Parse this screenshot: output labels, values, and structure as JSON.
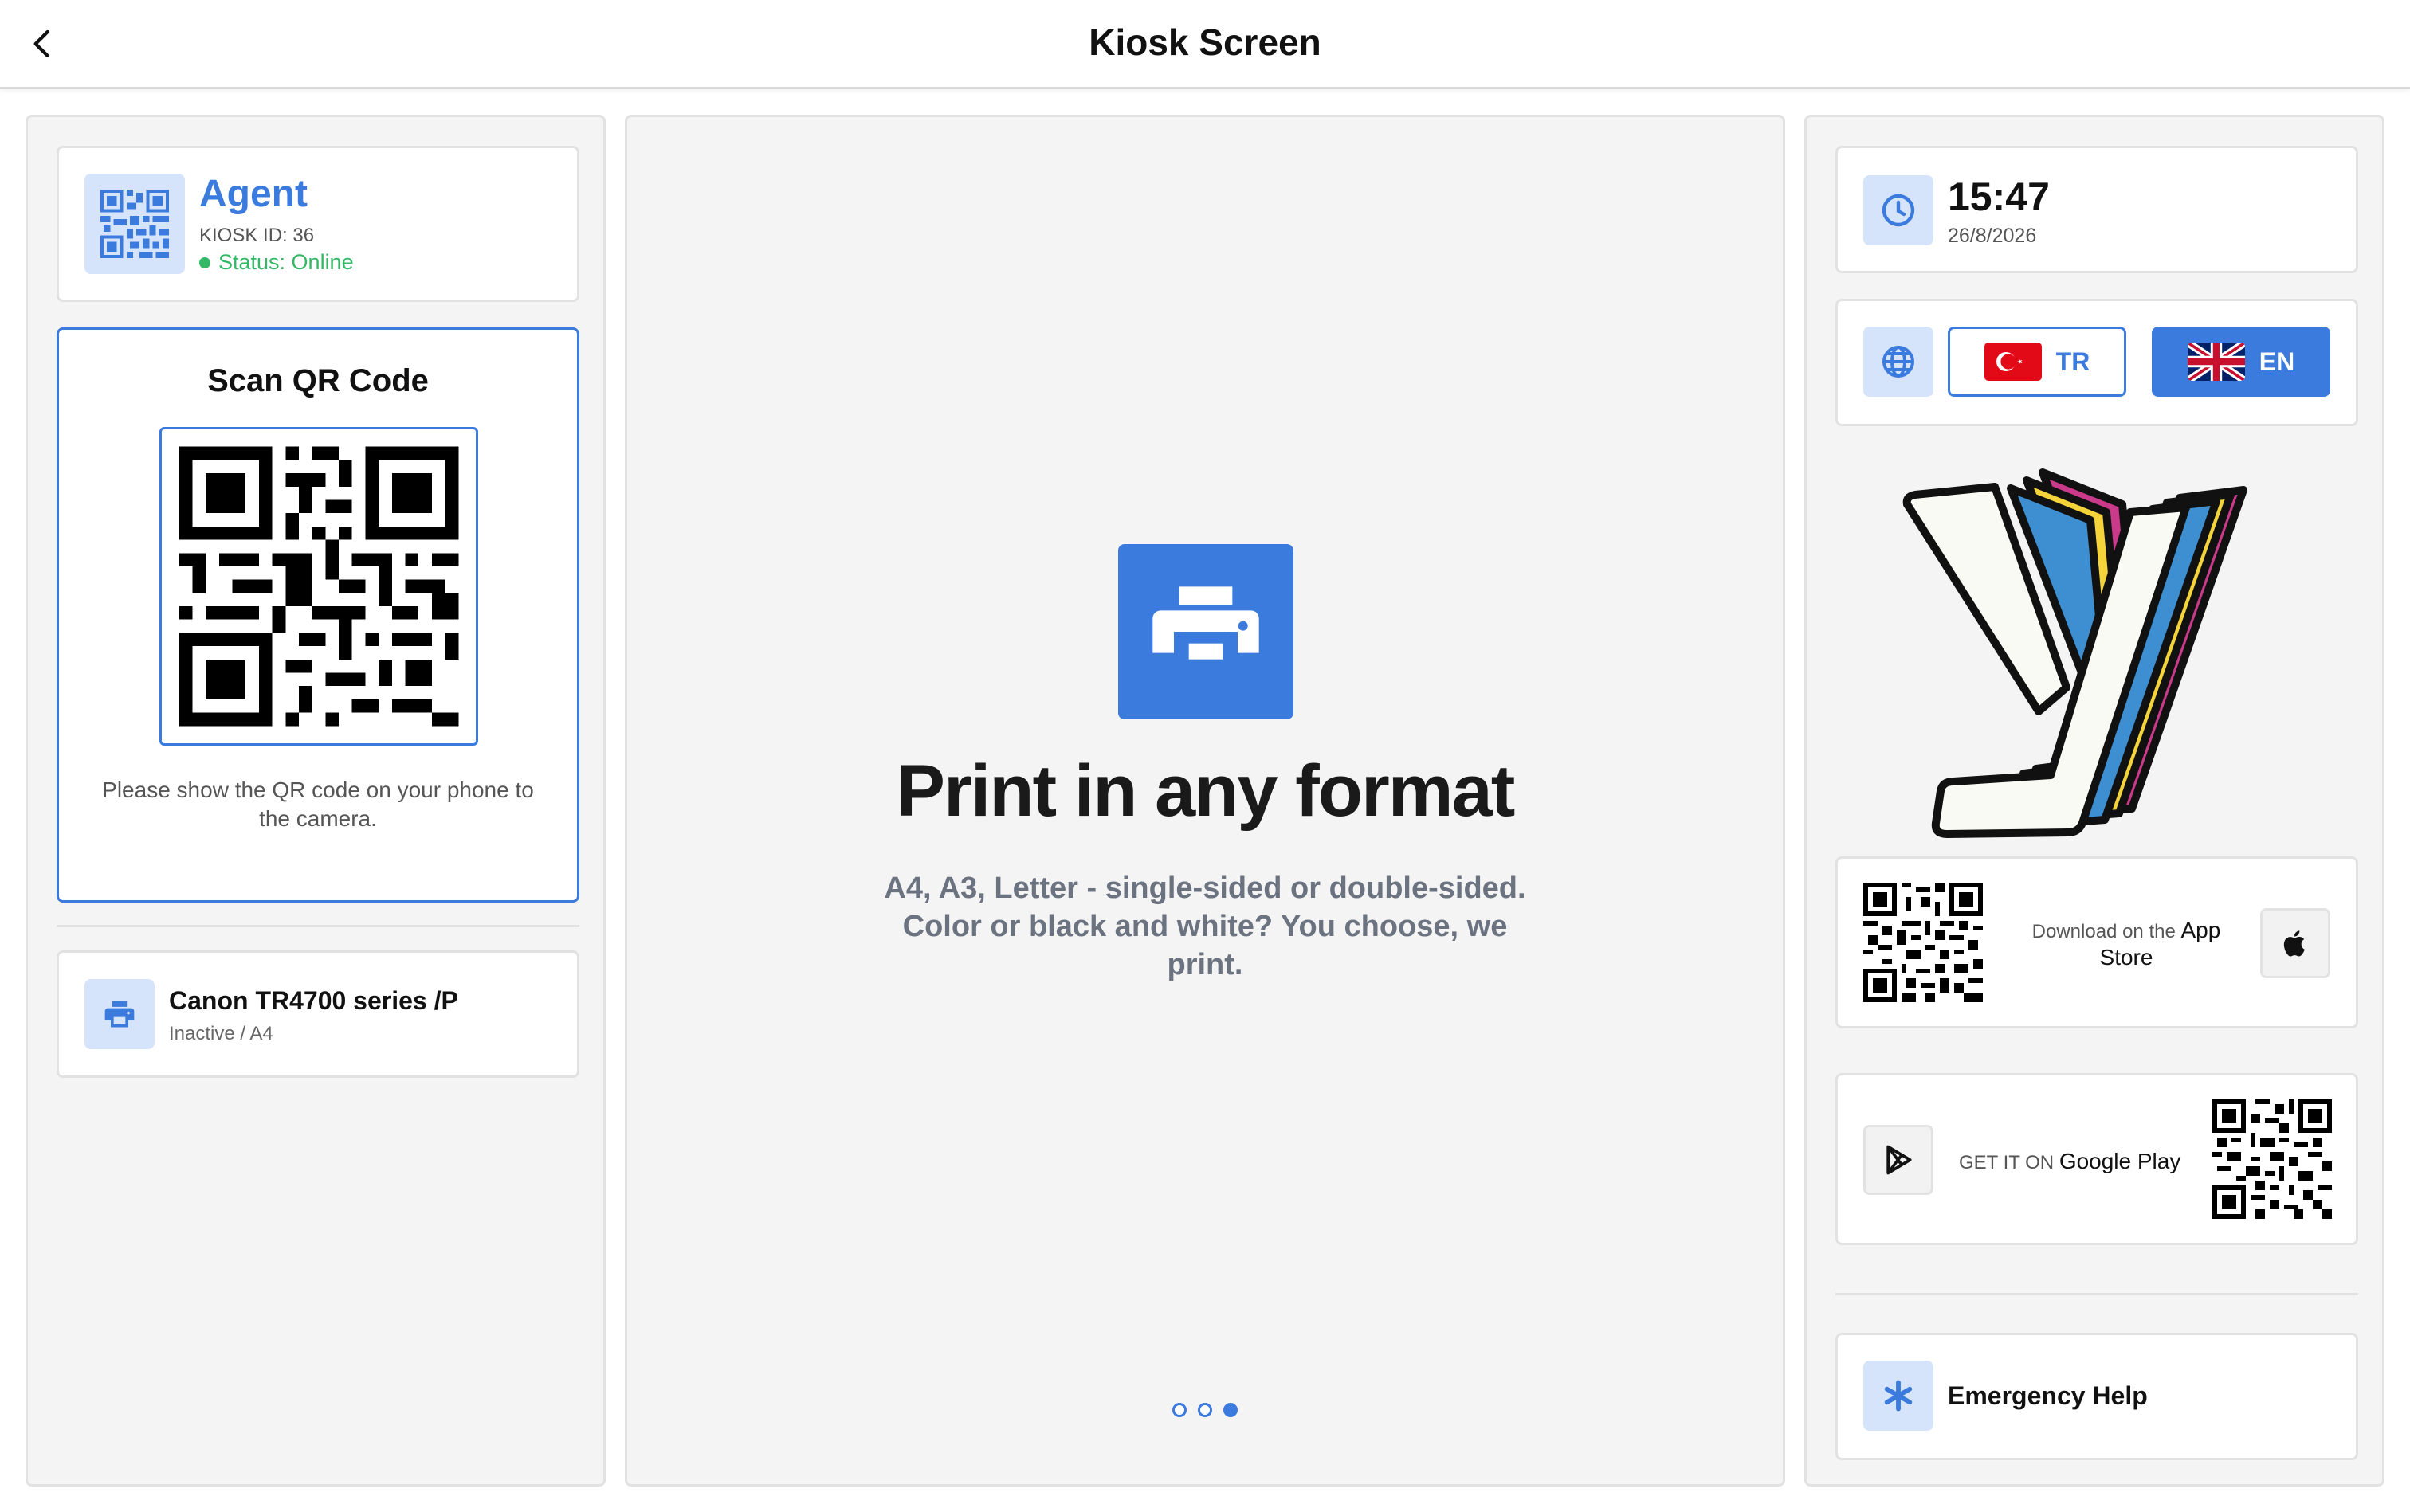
{
  "header": {
    "title": "Kiosk Screen",
    "back_icon": "chevron-left-icon"
  },
  "agent": {
    "name": "Agent",
    "kiosk_id": "KIOSK ID: 36",
    "status": "Status: Online",
    "icon": "qr-grid-icon",
    "status_color": "#34b866"
  },
  "scan": {
    "title": "Scan QR Code",
    "note": "Please show the QR code on your phone to the camera."
  },
  "printer": {
    "name": "Canon TR4700 series /P",
    "status": "Inactive / A4",
    "icon": "printer-icon"
  },
  "slide": {
    "title": "Print in any format",
    "text": "A4, A3, Letter - single-sided or double-sided. Color or black and white? You choose, we print.",
    "icon": "printer-icon",
    "pages": 3,
    "active_page": 3
  },
  "clock": {
    "time": "15:47",
    "date": "26/8/2026",
    "icon": "clock-icon"
  },
  "language": {
    "icon": "globe-icon",
    "options": [
      {
        "code": "TR",
        "flag": "turkey-flag",
        "selected": false
      },
      {
        "code": "EN",
        "flag": "uk-flag",
        "selected": true
      }
    ]
  },
  "logo": {
    "icon": "y-brand-logo"
  },
  "app_store": {
    "prefix": "Download on the",
    "name": "App Store",
    "icon": "apple-icon"
  },
  "google_play": {
    "prefix": "GET IT ON",
    "name": "Google Play",
    "icon": "play-store-icon"
  },
  "help": {
    "label": "Emergency Help",
    "icon": "asterisk-icon"
  },
  "colors": {
    "accent": "#3b7bde",
    "accent_light": "#d6e4fb",
    "online": "#34b866",
    "panel": "#f4f4f4"
  }
}
